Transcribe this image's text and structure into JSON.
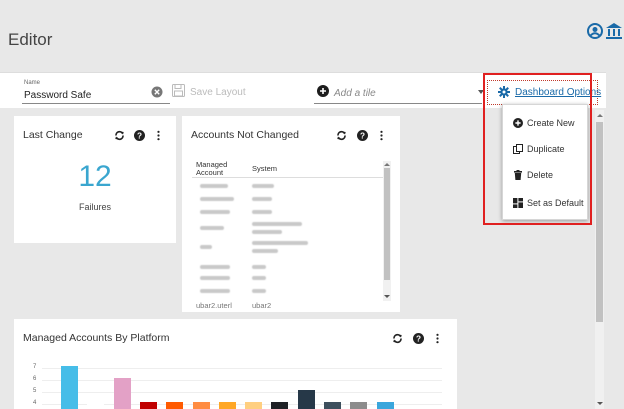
{
  "page": {
    "title": "Editor"
  },
  "header": {
    "user_icon": "user-circle-icon",
    "home_icon": "bank-icon"
  },
  "toolbar": {
    "name_label": "Name",
    "name_value": "Password Safe",
    "save_label": "Save Layout",
    "add_tile_placeholder": "Add a tile",
    "dashboard_options_label": "Dashboard Options"
  },
  "dashboard_menu": {
    "items": [
      {
        "label": "Create New",
        "icon": "plus-circle-icon"
      },
      {
        "label": "Duplicate",
        "icon": "duplicate-icon"
      },
      {
        "label": "Delete",
        "icon": "trash-icon"
      },
      {
        "label": "Set as Default",
        "icon": "dashboard-icon"
      }
    ]
  },
  "tiles": {
    "last_change": {
      "title": "Last Change",
      "value": "12",
      "subtitle": "Failures"
    },
    "accounts_not_changed": {
      "title": "Accounts Not Changed",
      "columns": [
        "Managed Account",
        "System"
      ],
      "last_row": [
        "ubar2.uterl",
        "ubar2"
      ]
    },
    "by_platform": {
      "title": "Managed Accounts By Platform"
    }
  },
  "chart_data": {
    "type": "bar",
    "title": "Managed Accounts By Platform",
    "yticks": [
      "4",
      "5",
      "6",
      "7"
    ],
    "ylim": [
      4,
      7.4
    ],
    "grid": true,
    "values": [
      7,
      4,
      6,
      4,
      4,
      4,
      4,
      4,
      4,
      5,
      4,
      4,
      4
    ],
    "colors": [
      "#46bde8",
      "#ffffff",
      "#e3a1c6",
      "#c00000",
      "#ff5a00",
      "#ff8c42",
      "#ffa726",
      "#ffcf80",
      "#1e2125",
      "#263848",
      "#3d4f5d",
      "#8c8c8c",
      "#3aa6dc"
    ]
  }
}
